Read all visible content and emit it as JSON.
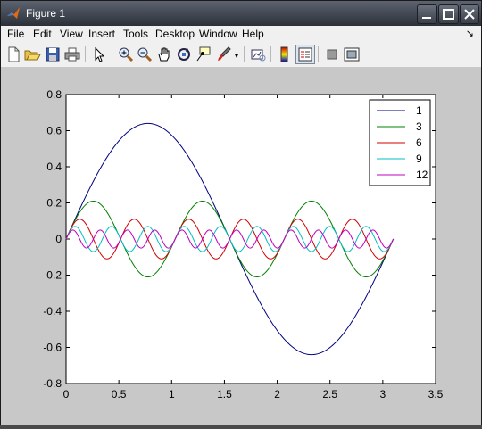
{
  "window": {
    "title": "Figure 1"
  },
  "menubar": {
    "items": [
      "File",
      "Edit",
      "View",
      "Insert",
      "Tools",
      "Desktop",
      "Window",
      "Help"
    ],
    "dock_arrow": "↘"
  },
  "toolbar": {
    "buttons": [
      {
        "name": "new-figure-icon"
      },
      {
        "name": "open-file-icon"
      },
      {
        "name": "save-icon"
      },
      {
        "name": "print-icon"
      },
      {
        "name": "edit-plot-arrow-icon"
      },
      {
        "name": "zoom-in-icon"
      },
      {
        "name": "zoom-out-icon"
      },
      {
        "name": "pan-hand-icon"
      },
      {
        "name": "rotate-3d-icon"
      },
      {
        "name": "data-cursor-icon"
      },
      {
        "name": "brush-icon"
      },
      {
        "name": "link-plot-icon"
      },
      {
        "name": "colorbar-icon"
      },
      {
        "name": "legend-icon"
      },
      {
        "name": "hide-plot-tools-icon"
      },
      {
        "name": "show-plot-tools-icon"
      }
    ]
  },
  "chart_data": {
    "type": "line",
    "title": "",
    "xlabel": "",
    "ylabel": "",
    "xlim": [
      0,
      3.5
    ],
    "ylim": [
      -0.8,
      0.8
    ],
    "xticks": [
      "0",
      "0.5",
      "1",
      "1.5",
      "2",
      "2.5",
      "3",
      "3.5"
    ],
    "yticks": [
      "0.8",
      "0.6",
      "0.4",
      "0.2",
      "0",
      "-0.2",
      "-0.4",
      "-0.6",
      "-0.8"
    ],
    "grid": false,
    "legend_position": "top-right",
    "x_range": [
      0,
      3.1
    ],
    "series": [
      {
        "name": "1",
        "color": "#000080",
        "peak": 0.64,
        "valley": -0.64,
        "cycles": 1
      },
      {
        "name": "3",
        "color": "#008000",
        "peak": 0.21,
        "valley": -0.21,
        "cycles": 3
      },
      {
        "name": "6",
        "color": "#d00000",
        "peak": 0.11,
        "valley": -0.11,
        "cycles": 6
      },
      {
        "name": "9",
        "color": "#00c0c0",
        "peak": 0.07,
        "valley": -0.07,
        "cycles": 9
      },
      {
        "name": "12",
        "color": "#c000c0",
        "peak": 0.05,
        "valley": -0.05,
        "cycles": 12
      }
    ]
  }
}
